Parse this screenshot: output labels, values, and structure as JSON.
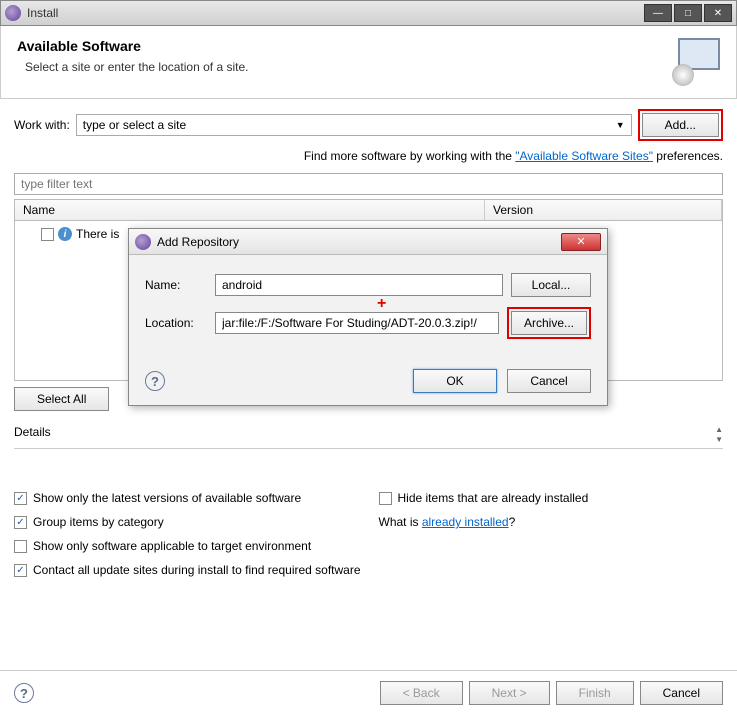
{
  "window": {
    "title": "Install"
  },
  "header": {
    "title": "Available Software",
    "subtitle": "Select a site or enter the location of a site."
  },
  "workwith": {
    "label": "Work with:",
    "placeholder": "type or select a site",
    "add": "Add..."
  },
  "hint": {
    "prefix": "Find more software by working with the ",
    "link": "\"Available Software Sites\"",
    "suffix": " preferences."
  },
  "filter": {
    "placeholder": "type filter text"
  },
  "table": {
    "col_name": "Name",
    "col_version": "Version",
    "row_text": "There is"
  },
  "buttons": {
    "select_all": "Select All",
    "back": "< Back",
    "next": "Next >",
    "finish": "Finish",
    "cancel": "Cancel"
  },
  "details": {
    "label": "Details"
  },
  "options": {
    "latest": "Show only the latest versions of available software",
    "hide": "Hide items that are already installed",
    "group": "Group items by category",
    "whatis_prefix": "What is ",
    "whatis_link": "already installed",
    "whatis_suffix": "?",
    "applicable": "Show only software applicable to target environment",
    "contact": "Contact all update sites during install to find required software"
  },
  "modal": {
    "title": "Add Repository",
    "name_label": "Name:",
    "name_value": "android",
    "local": "Local...",
    "location_label": "Location:",
    "location_value": "jar:file:/F:/Software For Studing/ADT-20.0.3.zip!/",
    "archive": "Archive...",
    "ok": "OK",
    "cancel": "Cancel"
  }
}
